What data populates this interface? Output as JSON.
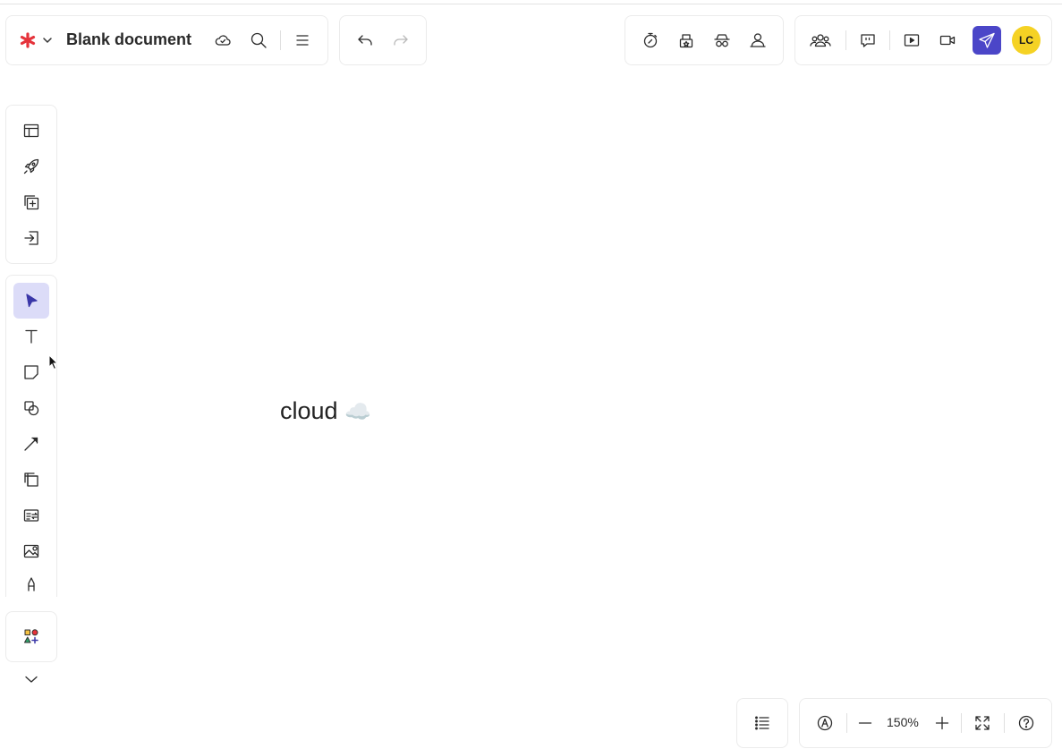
{
  "header": {
    "doc_title": "Blank document",
    "avatar_initials": "LC"
  },
  "canvas": {
    "text": "cloud",
    "emoji": "☁️"
  },
  "footer": {
    "zoom_level": "150%"
  },
  "colors": {
    "brand": "#e5333b",
    "share": "#4b46c8",
    "avatar": "#f5d224",
    "active_tool": "#dcdcf8"
  }
}
